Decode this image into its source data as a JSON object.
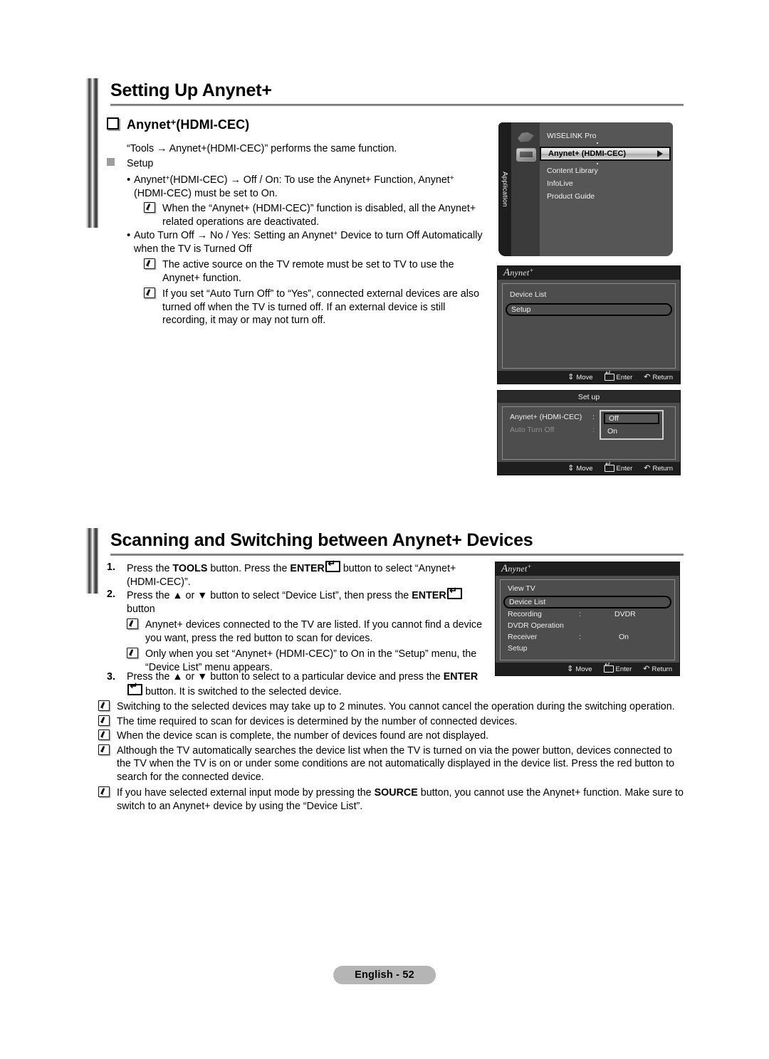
{
  "document": {
    "footer_label": "English - 52"
  },
  "section1": {
    "heading": "Setting Up Anynet+",
    "subheading_pre": "Anynet",
    "subheading_post": "(HDMI-CEC)",
    "tools_note": "“Tools → Anynet+(HDMI-CEC)” performs the same function.",
    "setup_label": "Setup",
    "bullets": [
      {
        "text_a": "Anynet",
        "text_b": "(HDMI-CEC) → Off / On: To use the Anynet+ Function, Anynet",
        "text_c": "(HDMI-CEC) must be set to On.",
        "notes": [
          "When the “Anynet+ (HDMI-CEC)” function is disabled, all the Anynet+ related operations are deactivated."
        ]
      },
      {
        "text_a": "Auto Turn Off → No / Yes: Setting an Anynet",
        "text_b": " Device to turn Off Automatically when the TV is Turned Off",
        "notes": [
          "The active source on the TV remote must be set to TV to use the Anynet+ function.",
          "If you set “Auto Turn Off” to “Yes”, connected external devices are also turned off when the TV is turned off. If an external device is still recording, it may or may not turn off."
        ]
      }
    ]
  },
  "section2": {
    "heading": "Scanning and Switching between Anynet+ Devices",
    "steps": [
      {
        "num": "1.",
        "parts": [
          "Press the ",
          "TOOLS",
          " button. Press the ",
          "ENTER",
          " button to select “Anynet+ (HDMI-CEC)”."
        ],
        "notes": []
      },
      {
        "num": "2.",
        "parts": [
          "Press the ▲ or ▼ button to select “Device List”, then press the ",
          "ENTER",
          " button"
        ],
        "notes": [
          "Anynet+ devices connected to the TV are listed. If you cannot find a device you want, press the red button to scan for devices.",
          "Only when you set “Anynet+ (HDMI-CEC)” to On in the “Setup” menu, the “Device List” menu appears."
        ]
      },
      {
        "num": "3.",
        "parts": [
          "Press the ▲ or ▼ button to select to a particular device and press the ",
          "ENTER",
          " button. It is switched to the selected device."
        ],
        "notes": []
      }
    ],
    "final_notes": [
      "Switching to the selected devices may take up to 2 minutes. You cannot cancel the operation during the switching operation.",
      "The time required to scan for devices is determined by the number of connected devices.",
      "When the device scan is complete, the number of devices found are not displayed.",
      "Although the TV automatically searches the device list when the TV is turned on via the power button, devices connected to the TV when the TV is on or under some conditions are not automatically displayed in the device list. Press the red button to search for the connected device."
    ],
    "source_note": {
      "pre": "If you have selected external input mode by pressing the ",
      "bold": "SOURCE",
      "post": " button, you cannot use the Anynet+ function. Make sure to switch to an Anynet+ device by using the “Device List”."
    }
  },
  "osd": {
    "panel_application": {
      "sidebar_label": "Application",
      "items": [
        {
          "label": "WISELINK Pro",
          "selected": false
        },
        {
          "label": "Anynet+ (HDMI-CEC)",
          "selected": true
        },
        {
          "label": "Content Library",
          "selected": false
        },
        {
          "label": "InfoLive",
          "selected": false
        },
        {
          "label": "Product Guide",
          "selected": false
        }
      ]
    },
    "panel_anynet_main": {
      "logo_a": "A",
      "logo_b": "nynet",
      "logo_sup": "+",
      "items": [
        {
          "label": "Device List",
          "selected": false
        },
        {
          "label": "Setup",
          "selected": true
        }
      ],
      "footer": {
        "move": "Move",
        "enter": "Enter",
        "return": "Return"
      }
    },
    "panel_setup": {
      "title": "Set up",
      "rows": [
        {
          "label": "Anynet+ (HDMI-CEC)",
          "colon": ":",
          "dim": false
        },
        {
          "label": "Auto Turn Off",
          "colon": ":",
          "dim": true
        }
      ],
      "options": [
        {
          "label": "Off",
          "selected": true
        },
        {
          "label": "On",
          "selected": false
        }
      ],
      "footer": {
        "move": "Move",
        "enter": "Enter",
        "return": "Return"
      }
    },
    "panel_device_list": {
      "logo_a": "A",
      "logo_b": "nynet",
      "logo_sup": "+",
      "rows": [
        {
          "label": "View TV",
          "colon": "",
          "value": "",
          "selected": false
        },
        {
          "label": "Device List",
          "colon": "",
          "value": "",
          "selected": true
        },
        {
          "label": "Recording",
          "colon": ":",
          "value": "DVDR",
          "selected": false
        },
        {
          "label": "DVDR Operation",
          "colon": "",
          "value": "",
          "selected": false
        },
        {
          "label": "Receiver",
          "colon": ":",
          "value": "On",
          "selected": false
        },
        {
          "label": "Setup",
          "colon": "",
          "value": "",
          "selected": false
        }
      ],
      "footer": {
        "move": "Move",
        "enter": "Enter",
        "return": "Return"
      }
    }
  }
}
